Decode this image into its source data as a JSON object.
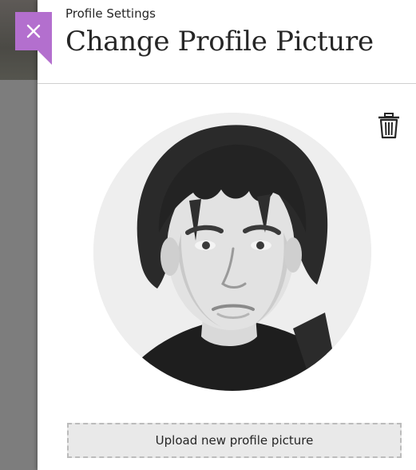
{
  "header": {
    "breadcrumb": "Profile Settings",
    "title": "Change Profile Picture"
  },
  "icons": {
    "close": "close-icon",
    "delete": "trash-icon"
  },
  "profile": {
    "upload_label": "Upload new profile picture"
  },
  "colors": {
    "accent": "#b36fce",
    "backdrop": "#7d7d7d",
    "divider": "#cfcfcf",
    "upload_bg": "#e9e9e9"
  }
}
